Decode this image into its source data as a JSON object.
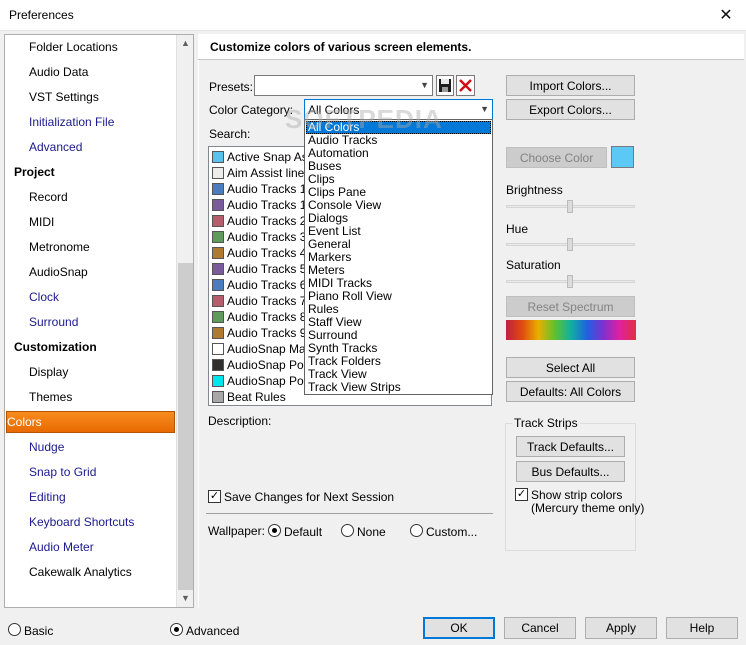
{
  "window": {
    "title": "Preferences",
    "close_glyph": "✕"
  },
  "nav": {
    "items": [
      {
        "label": "Folder Locations",
        "kind": "child"
      },
      {
        "label": "Audio Data",
        "kind": "child"
      },
      {
        "label": "VST Settings",
        "kind": "child"
      },
      {
        "label": "Initialization File",
        "kind": "link"
      },
      {
        "label": "Advanced",
        "kind": "link"
      },
      {
        "label": "Project",
        "kind": "head"
      },
      {
        "label": "Record",
        "kind": "child"
      },
      {
        "label": "MIDI",
        "kind": "child"
      },
      {
        "label": "Metronome",
        "kind": "child"
      },
      {
        "label": "AudioSnap",
        "kind": "child"
      },
      {
        "label": "Clock",
        "kind": "link"
      },
      {
        "label": "Surround",
        "kind": "link"
      },
      {
        "label": "Customization",
        "kind": "head"
      },
      {
        "label": "Display",
        "kind": "child"
      },
      {
        "label": "Themes",
        "kind": "child"
      },
      {
        "label": "Colors",
        "kind": "selected"
      },
      {
        "label": "Nudge",
        "kind": "link"
      },
      {
        "label": "Snap to Grid",
        "kind": "link"
      },
      {
        "label": "Editing",
        "kind": "link"
      },
      {
        "label": "Keyboard Shortcuts",
        "kind": "link"
      },
      {
        "label": "Audio Meter",
        "kind": "link"
      },
      {
        "label": "Cakewalk Analytics",
        "kind": "child"
      }
    ]
  },
  "header": {
    "title": "Customize colors of various screen elements."
  },
  "presets": {
    "label": "Presets:",
    "value": "",
    "save_icon": "floppy-disk-icon",
    "delete_icon": "red-x-icon"
  },
  "color_category": {
    "label": "Color Category:",
    "value": "All Colors"
  },
  "search": {
    "label": "Search:"
  },
  "elements": [
    {
      "label": "Active Snap Ass",
      "color": "#5bc0eb"
    },
    {
      "label": "Aim Assist line",
      "color": "#ececec"
    },
    {
      "label": "Audio Tracks 1,",
      "color": "#4a7cc2"
    },
    {
      "label": "Audio Tracks 10",
      "color": "#7c5a9e"
    },
    {
      "label": "Audio Tracks 2,",
      "color": "#b85c6b"
    },
    {
      "label": "Audio Tracks 3,",
      "color": "#5e9c5b"
    },
    {
      "label": "Audio Tracks 4,",
      "color": "#b07a2e"
    },
    {
      "label": "Audio Tracks 5,",
      "color": "#7c5a9e"
    },
    {
      "label": "Audio Tracks 6,",
      "color": "#4a7cc2"
    },
    {
      "label": "Audio Tracks 7,",
      "color": "#b85c6b"
    },
    {
      "label": "Audio Tracks 8,",
      "color": "#5e9c5b"
    },
    {
      "label": "Audio Tracks 9,",
      "color": "#b07a2e"
    },
    {
      "label": "AudioSnap Mark",
      "color": "#ffffff"
    },
    {
      "label": "AudioSnap Pool",
      "color": "#303030"
    },
    {
      "label": "AudioSnap Pool",
      "color": "#00e5ee"
    },
    {
      "label": "Beat Rules",
      "color": "#a8a8a8"
    }
  ],
  "dropdown_options": [
    "All Colors",
    "Audio Tracks",
    "Automation",
    "Buses",
    "Clips",
    "Clips Pane",
    "Console View",
    "Dialogs",
    "Event List",
    "General",
    "Markers",
    "Meters",
    "MIDI Tracks",
    "Piano Roll View",
    "Rules",
    "Staff View",
    "Surround",
    "Synth Tracks",
    "Track Folders",
    "Track View",
    "Track View Strips"
  ],
  "watermark": "SOFTPEDIA",
  "description": {
    "label": "Description:"
  },
  "save_changes": {
    "label": "Save Changes for Next Session",
    "checked": true
  },
  "wallpaper": {
    "label": "Wallpaper:",
    "options": [
      "Default",
      "None",
      "Custom..."
    ],
    "selected": "Default"
  },
  "right": {
    "import_label": "Import Colors...",
    "export_label": "Export Colors...",
    "choose_color_label": "Choose Color",
    "swatch_color": "#5bc8f5",
    "brightness_label": "Brightness",
    "hue_label": "Hue",
    "saturation_label": "Saturation",
    "reset_spectrum_label": "Reset Spectrum",
    "select_all_label": "Select All",
    "defaults_label": "Defaults: All Colors"
  },
  "track_strips": {
    "title": "Track Strips",
    "track_defaults_label": "Track Defaults...",
    "bus_defaults_label": "Bus Defaults...",
    "show_strip_label": "Show strip colors",
    "show_strip_sub": "(Mercury theme only)",
    "show_strip_checked": true
  },
  "footer": {
    "basic_label": "Basic",
    "advanced_label": "Advanced",
    "mode": "Advanced",
    "ok_label": "OK",
    "cancel_label": "Cancel",
    "apply_label": "Apply",
    "help_label": "Help"
  }
}
